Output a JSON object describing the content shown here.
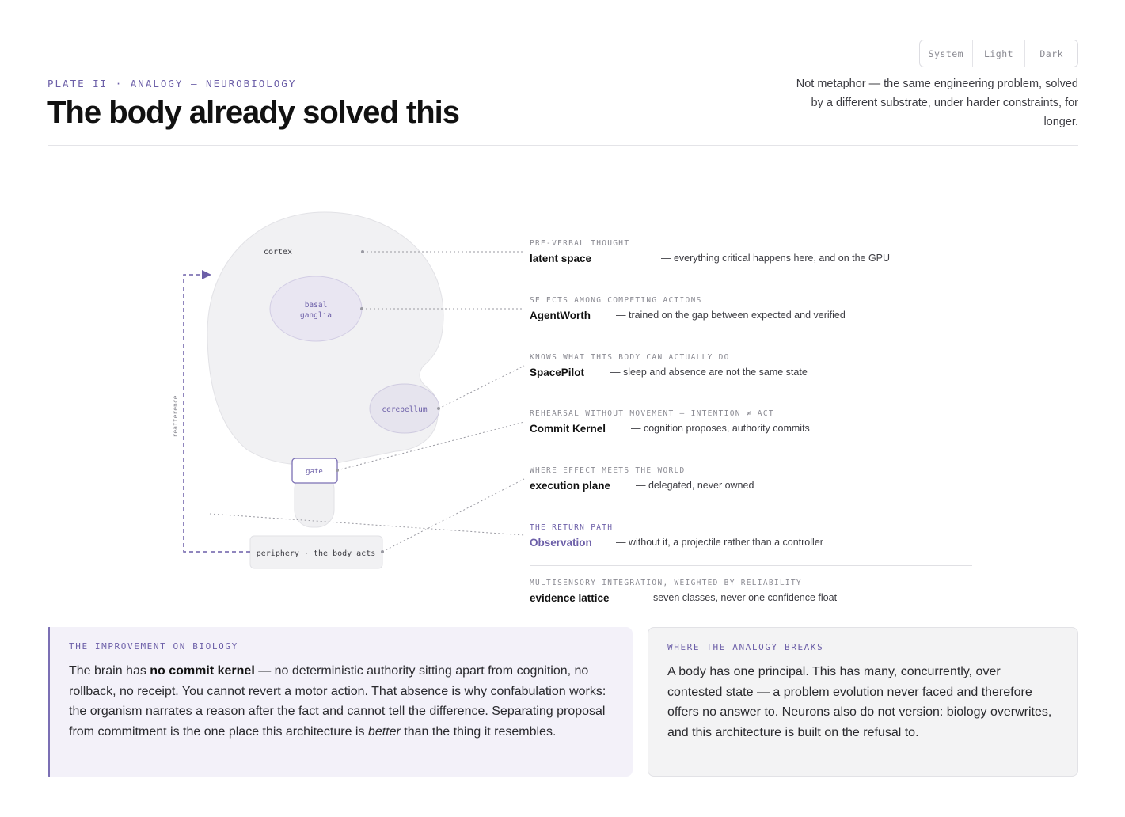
{
  "theme_switch": {
    "options": [
      "System",
      "Light",
      "Dark"
    ]
  },
  "header": {
    "eyebrow": "PLATE II · ANALOGY — NEUROBIOLOGY",
    "title": "The body already solved this",
    "subtitle": "Not metaphor — the same engineering problem, solved by a different substrate, under harder constraints, for longer."
  },
  "diagram": {
    "cortex_label": "cortex",
    "basal_ganglia_line1": "basal",
    "basal_ganglia_line2": "ganglia",
    "cerebellum_label": "cerebellum",
    "gate_label": "gate",
    "periphery_label": "periphery · the body acts",
    "reafference_label": "reafference",
    "accent_color": "#6c5fa8"
  },
  "annotations": [
    {
      "tag": "PRE-VERBAL THOUGHT",
      "name": "latent space",
      "desc": "— everything critical happens here, and on the GPU"
    },
    {
      "tag": "SELECTS AMONG COMPETING ACTIONS",
      "name": "AgentWorth",
      "desc": "— trained on the gap between expected and verified"
    },
    {
      "tag": "KNOWS WHAT THIS BODY CAN ACTUALLY DO",
      "name": "SpacePilot",
      "desc": "— sleep and absence are not the same state"
    },
    {
      "tag": "REHEARSAL WITHOUT MOVEMENT — INTENTION ≠ ACT",
      "name": "Commit Kernel",
      "desc": "— cognition proposes, authority commits"
    },
    {
      "tag": "WHERE EFFECT MEETS THE WORLD",
      "name": "execution plane",
      "desc": "— delegated, never owned"
    },
    {
      "tag": "THE RETURN PATH",
      "name": "Observation",
      "desc": "— without it, a projectile rather than a controller"
    },
    {
      "tag": "MULTISENSORY INTEGRATION, WEIGHTED BY RELIABILITY",
      "name": "evidence lattice",
      "desc": "— seven classes, never one confidence float"
    }
  ],
  "cards": {
    "left": {
      "label": "THE IMPROVEMENT ON BIOLOGY",
      "pre": "The brain has ",
      "strong": "no commit kernel",
      "mid": " — no deterministic authority sitting apart from cognition, no rollback, no receipt. You cannot revert a motor action. That absence is why confabulation works: the organism narrates a reason after the fact and cannot tell the difference. Separating proposal from commitment is the one place this architecture is ",
      "em": "better",
      "post": " than the thing it resembles."
    },
    "right": {
      "label": "WHERE THE ANALOGY BREAKS",
      "body": "A body has one principal. This has many, concurrently, over contested state — a problem evolution never faced and therefore offers no answer to. Neurons also do not version: biology overwrites, and this architecture is built on the refusal to."
    }
  }
}
